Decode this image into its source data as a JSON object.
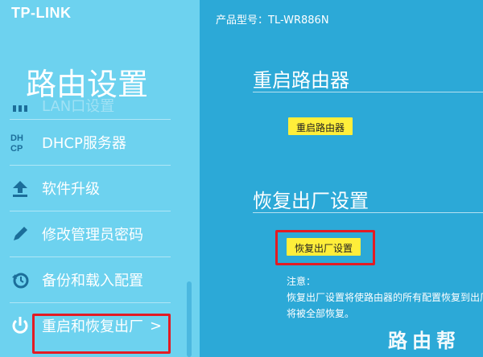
{
  "brand": "TP-LINK",
  "sidebar": {
    "title": "路由设置",
    "items": [
      {
        "label": "LAN口设置",
        "icon": "lan-icon"
      },
      {
        "label": "DHCP服务器",
        "icon": "dhcp-icon"
      },
      {
        "label": "软件升级",
        "icon": "upload-icon"
      },
      {
        "label": "修改管理员密码",
        "icon": "pencil-icon"
      },
      {
        "label": "备份和载入配置",
        "icon": "history-icon"
      },
      {
        "label": "重启和恢复出厂",
        "icon": "power-icon",
        "chevron": ">"
      }
    ]
  },
  "header": {
    "model": "产品型号：TL-WR886N"
  },
  "main": {
    "reboot": {
      "title": "重启路由器",
      "button": "重启路由器"
    },
    "reset": {
      "title": "恢复出厂设置",
      "button": "恢复出厂设置",
      "note_label": "注意：",
      "note_line1": "恢复出厂设置将使路由器的所有配置恢复到出厂",
      "note_line2": "将被全部恢复。"
    }
  },
  "watermark": "路由帮",
  "colors": {
    "sidebar_bg": "#6dd2ef",
    "main_bg": "#2ca9d7",
    "button_bg": "#ffee3a",
    "highlight": "#e31b23"
  }
}
